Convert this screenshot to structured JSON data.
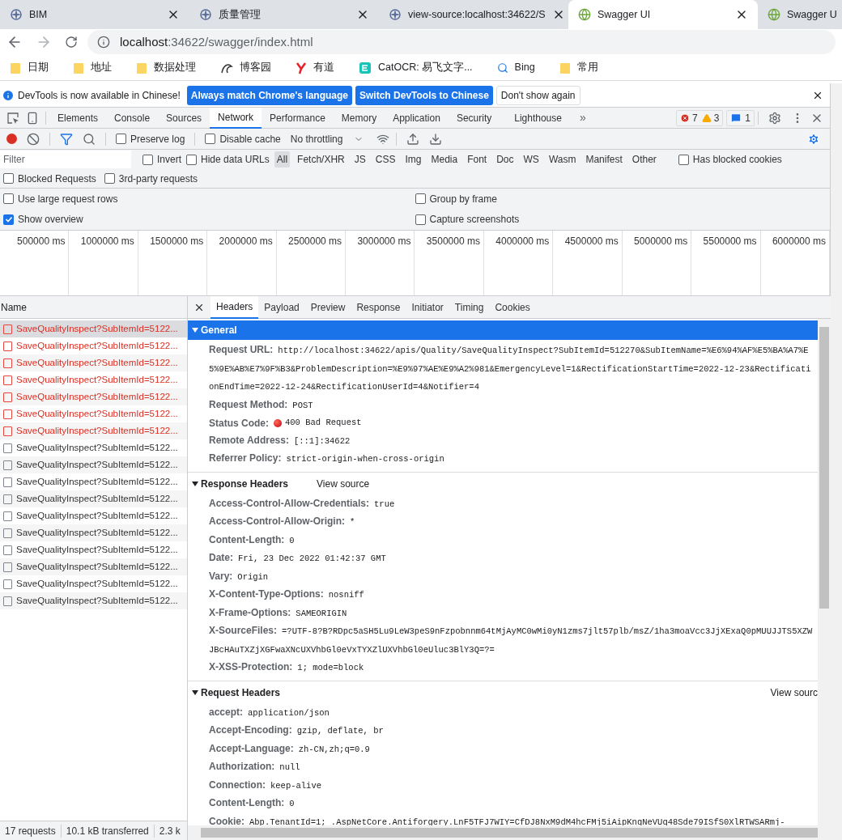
{
  "browser_tabs": [
    {
      "title": "BIM",
      "kind": "compass",
      "selected": false
    },
    {
      "title": "质量管理",
      "kind": "compass",
      "selected": false
    },
    {
      "title": "view-source:localhost:34622/S",
      "kind": "compass",
      "selected": false
    },
    {
      "title": "Swagger UI",
      "kind": "globe",
      "selected": true
    },
    {
      "title": "Swagger U",
      "kind": "globe",
      "selected": false
    }
  ],
  "address_bar": {
    "host": "localhost",
    "path": ":34622/swagger/index.html"
  },
  "bookmarks": [
    {
      "label": "日期",
      "kind": "folder"
    },
    {
      "label": "地址",
      "kind": "folder"
    },
    {
      "label": "数据处理",
      "kind": "folder"
    },
    {
      "label": "博客园",
      "kind": "blog"
    },
    {
      "label": "有道",
      "kind": "dict"
    },
    {
      "label": "CatOCR: 易飞文字...",
      "kind": "ocr"
    },
    {
      "label": "Bing",
      "kind": "search"
    },
    {
      "label": "常用",
      "kind": "folder"
    }
  ],
  "infobar": {
    "message": "DevTools is now available in Chinese!",
    "buttons": [
      {
        "label": "Always match Chrome's language",
        "kind": "primary"
      },
      {
        "label": "Switch DevTools to Chinese",
        "kind": "primary"
      },
      {
        "label": "Don't show again",
        "kind": "secondary"
      }
    ]
  },
  "devtools_tabs": [
    {
      "label": "Elements",
      "selected": false
    },
    {
      "label": "Console",
      "selected": false
    },
    {
      "label": "Sources",
      "selected": false
    },
    {
      "label": "Network",
      "selected": true
    },
    {
      "label": "Performance",
      "selected": false
    },
    {
      "label": "Memory",
      "selected": false
    },
    {
      "label": "Application",
      "selected": false
    },
    {
      "label": "Security",
      "selected": false
    },
    {
      "label": "Lighthouse",
      "selected": false
    }
  ],
  "more_tabs": "»",
  "counters": {
    "errors": "7",
    "warnings": "3",
    "messages": "1"
  },
  "toolbar": {
    "preserve_log": {
      "label": "Preserve log",
      "checked": false
    },
    "disable_cache": {
      "label": "Disable cache",
      "checked": false
    },
    "throttling": "No throttling"
  },
  "filter": {
    "placeholder": "Filter"
  },
  "filter_row": [
    {
      "kind": "checkbox",
      "label": "Invert",
      "checked": false
    },
    {
      "kind": "checkbox",
      "label": "Hide data URLs",
      "checked": false
    },
    {
      "kind": "type",
      "label": "All",
      "selected": true
    },
    {
      "kind": "type",
      "label": "Fetch/XHR",
      "selected": false
    },
    {
      "kind": "type",
      "label": "JS",
      "selected": false
    },
    {
      "kind": "type",
      "label": "CSS",
      "selected": false
    },
    {
      "kind": "type",
      "label": "Img",
      "selected": false
    },
    {
      "kind": "type",
      "label": "Media",
      "selected": false
    },
    {
      "kind": "type",
      "label": "Font",
      "selected": false
    },
    {
      "kind": "type",
      "label": "Doc",
      "selected": false
    },
    {
      "kind": "type",
      "label": "WS",
      "selected": false
    },
    {
      "kind": "type",
      "label": "Wasm",
      "selected": false
    },
    {
      "kind": "type",
      "label": "Manifest",
      "selected": false
    },
    {
      "kind": "type",
      "label": "Other",
      "selected": false
    },
    {
      "kind": "checkbox",
      "label": "Has blocked cookies",
      "checked": false
    }
  ],
  "filter_row_2": [
    {
      "label": "Blocked Requests",
      "checked": false
    },
    {
      "label": "3rd-party requests",
      "checked": false
    }
  ],
  "settings": [
    {
      "label": "Use large request rows",
      "checked": false
    },
    {
      "label": "Group by frame",
      "checked": false
    },
    {
      "label": "Show overview",
      "checked": true
    },
    {
      "label": "Capture screenshots",
      "checked": false
    }
  ],
  "overview": {
    "ticks": [
      "500000 ms",
      "1000000 ms",
      "1500000 ms",
      "2000000 ms",
      "2500000 ms",
      "3000000 ms",
      "3500000 ms",
      "4000000 ms",
      "4500000 ms",
      "5000000 ms",
      "5500000 ms",
      "6000000 ms"
    ]
  },
  "requests": {
    "header": "Name",
    "rows": [
      {
        "name": "SaveQualityInspect?SubItemId=5122...",
        "error": true,
        "selected": true
      },
      {
        "name": "SaveQualityInspect?SubItemId=5122...",
        "error": true,
        "selected": false
      },
      {
        "name": "SaveQualityInspect?SubItemId=5122...",
        "error": true,
        "selected": false
      },
      {
        "name": "SaveQualityInspect?SubItemId=5122...",
        "error": true,
        "selected": false
      },
      {
        "name": "SaveQualityInspect?SubItemId=5122...",
        "error": true,
        "selected": false
      },
      {
        "name": "SaveQualityInspect?SubItemId=5122...",
        "error": true,
        "selected": false
      },
      {
        "name": "SaveQualityInspect?SubItemId=5122...",
        "error": true,
        "selected": false
      },
      {
        "name": "SaveQualityInspect?SubItemId=5122...",
        "error": false,
        "selected": false
      },
      {
        "name": "SaveQualityInspect?SubItemId=5122...",
        "error": false,
        "selected": false
      },
      {
        "name": "SaveQualityInspect?SubItemId=5122...",
        "error": false,
        "selected": false
      },
      {
        "name": "SaveQualityInspect?SubItemId=5122...",
        "error": false,
        "selected": false
      },
      {
        "name": "SaveQualityInspect?SubItemId=5122...",
        "error": false,
        "selected": false
      },
      {
        "name": "SaveQualityInspect?SubItemId=5122...",
        "error": false,
        "selected": false
      },
      {
        "name": "SaveQualityInspect?SubItemId=5122...",
        "error": false,
        "selected": false
      },
      {
        "name": "SaveQualityInspect?SubItemId=5122...",
        "error": false,
        "selected": false
      },
      {
        "name": "SaveQualityInspect?SubItemId=5122...",
        "error": false,
        "selected": false
      },
      {
        "name": "SaveQualityInspect?SubItemId=5122...",
        "error": false,
        "selected": false
      }
    ]
  },
  "detail_tabs": [
    {
      "label": "Headers",
      "selected": true
    },
    {
      "label": "Payload",
      "selected": false
    },
    {
      "label": "Preview",
      "selected": false
    },
    {
      "label": "Response",
      "selected": false
    },
    {
      "label": "Initiator",
      "selected": false
    },
    {
      "label": "Timing",
      "selected": false
    },
    {
      "label": "Cookies",
      "selected": false
    }
  ],
  "sections": [
    {
      "title": "General",
      "selected": true,
      "expanded": true,
      "rows": [
        {
          "kind": "plain",
          "name": "Request URL:",
          "value": "http://localhost:34622/apis/Quality/SaveQualityInspect?SubItemId=512270&SubItemName=%E6%94%AF%E5%BA%A7%E5%9E%AB%E7%9F%B3&ProblemDescription=%E9%97%AE%E9%A2%981&EmergencyLevel=1&RectificationStartTime=2022-12-23&RectificationEndTime=2022-12-24&RectificationUserId=4&Notifier=4"
        },
        {
          "kind": "plain",
          "name": "Request Method:",
          "value": "POST"
        },
        {
          "kind": "status",
          "name": "Status Code:",
          "value": "400 Bad Request"
        },
        {
          "kind": "plain",
          "name": "Remote Address:",
          "value": "[::1]:34622"
        },
        {
          "kind": "plain",
          "name": "Referrer Policy:",
          "value": "strict-origin-when-cross-origin"
        }
      ]
    },
    {
      "title": "Response Headers",
      "view_source": "View source",
      "selected": false,
      "expanded": true,
      "rows": [
        {
          "kind": "plain",
          "name": "Access-Control-Allow-Credentials:",
          "value": "true"
        },
        {
          "kind": "plain",
          "name": "Access-Control-Allow-Origin:",
          "value": "*"
        },
        {
          "kind": "plain",
          "name": "Content-Length:",
          "value": "0"
        },
        {
          "kind": "plain",
          "name": "Date:",
          "value": "Fri, 23 Dec 2022 01:42:37 GMT"
        },
        {
          "kind": "plain",
          "name": "Vary:",
          "value": "Origin"
        },
        {
          "kind": "plain",
          "name": "X-Content-Type-Options:",
          "value": "nosniff"
        },
        {
          "kind": "plain",
          "name": "X-Frame-Options:",
          "value": "SAMEORIGIN"
        },
        {
          "kind": "plain",
          "name": "X-SourceFiles:",
          "value": "=?UTF-8?B?RDpc5aSH5Lu9LeW3peS9nFzpobnnm64tMjAyMC0wMi0yN1zms7jlt57plb/msZ/1ha3moaVcc3JjXExaQ0pMUUJJTS5XZWJBcHAuTXZjXGFwaXNcUXVhbGl0eVxTYXZlUXVhbGl0eUluc3BlY3Q=?="
        },
        {
          "kind": "plain",
          "name": "X-XSS-Protection:",
          "value": "1; mode=block"
        }
      ]
    },
    {
      "title": "Request Headers",
      "view_source": "View sourc",
      "selected": false,
      "expanded": true,
      "rows": [
        {
          "kind": "plain",
          "name": "accept:",
          "value": "application/json"
        },
        {
          "kind": "plain",
          "name": "Accept-Encoding:",
          "value": "gzip, deflate, br"
        },
        {
          "kind": "plain",
          "name": "Accept-Language:",
          "value": "zh-CN,zh;q=0.9"
        },
        {
          "kind": "plain",
          "name": "Authorization:",
          "value": "null"
        },
        {
          "kind": "plain",
          "name": "Connection:",
          "value": "keep-alive"
        },
        {
          "kind": "plain",
          "name": "Content-Length:",
          "value": "0"
        },
        {
          "kind": "plain",
          "name": "Cookie:",
          "value": "Abp.TenantId=1; .AspNetCore.Antiforgery.LnF5TFJ7WIY=CfDJ8NxM9dM4hcFMj5iAipKnqNeVUq48Sde79ISfS0XlRTWSARmj-"
        }
      ]
    }
  ],
  "status_bar": [
    "17 requests",
    "10.1 kB transferred",
    "2.3 k"
  ]
}
